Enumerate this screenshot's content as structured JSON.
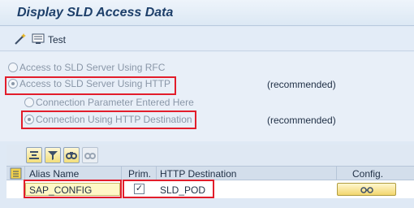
{
  "window": {
    "title": "Display SLD Access Data"
  },
  "toolbar": {
    "test_label": "Test"
  },
  "options": {
    "rfc_label": "Access to SLD Server Using RFC",
    "http_label": "Access to SLD Server Using HTTP",
    "http_note": "(recommended)",
    "param_label": "Connection Parameter Entered Here",
    "dest_label": "Connection Using HTTP Destination",
    "dest_note": "(recommended)"
  },
  "table": {
    "columns": [
      "Alias Name",
      "Prim.",
      "HTTP Destination",
      "Config."
    ],
    "rows": [
      {
        "alias": "SAP_CONFIG",
        "prim": "✓",
        "destination": "SLD_POD"
      }
    ]
  }
}
